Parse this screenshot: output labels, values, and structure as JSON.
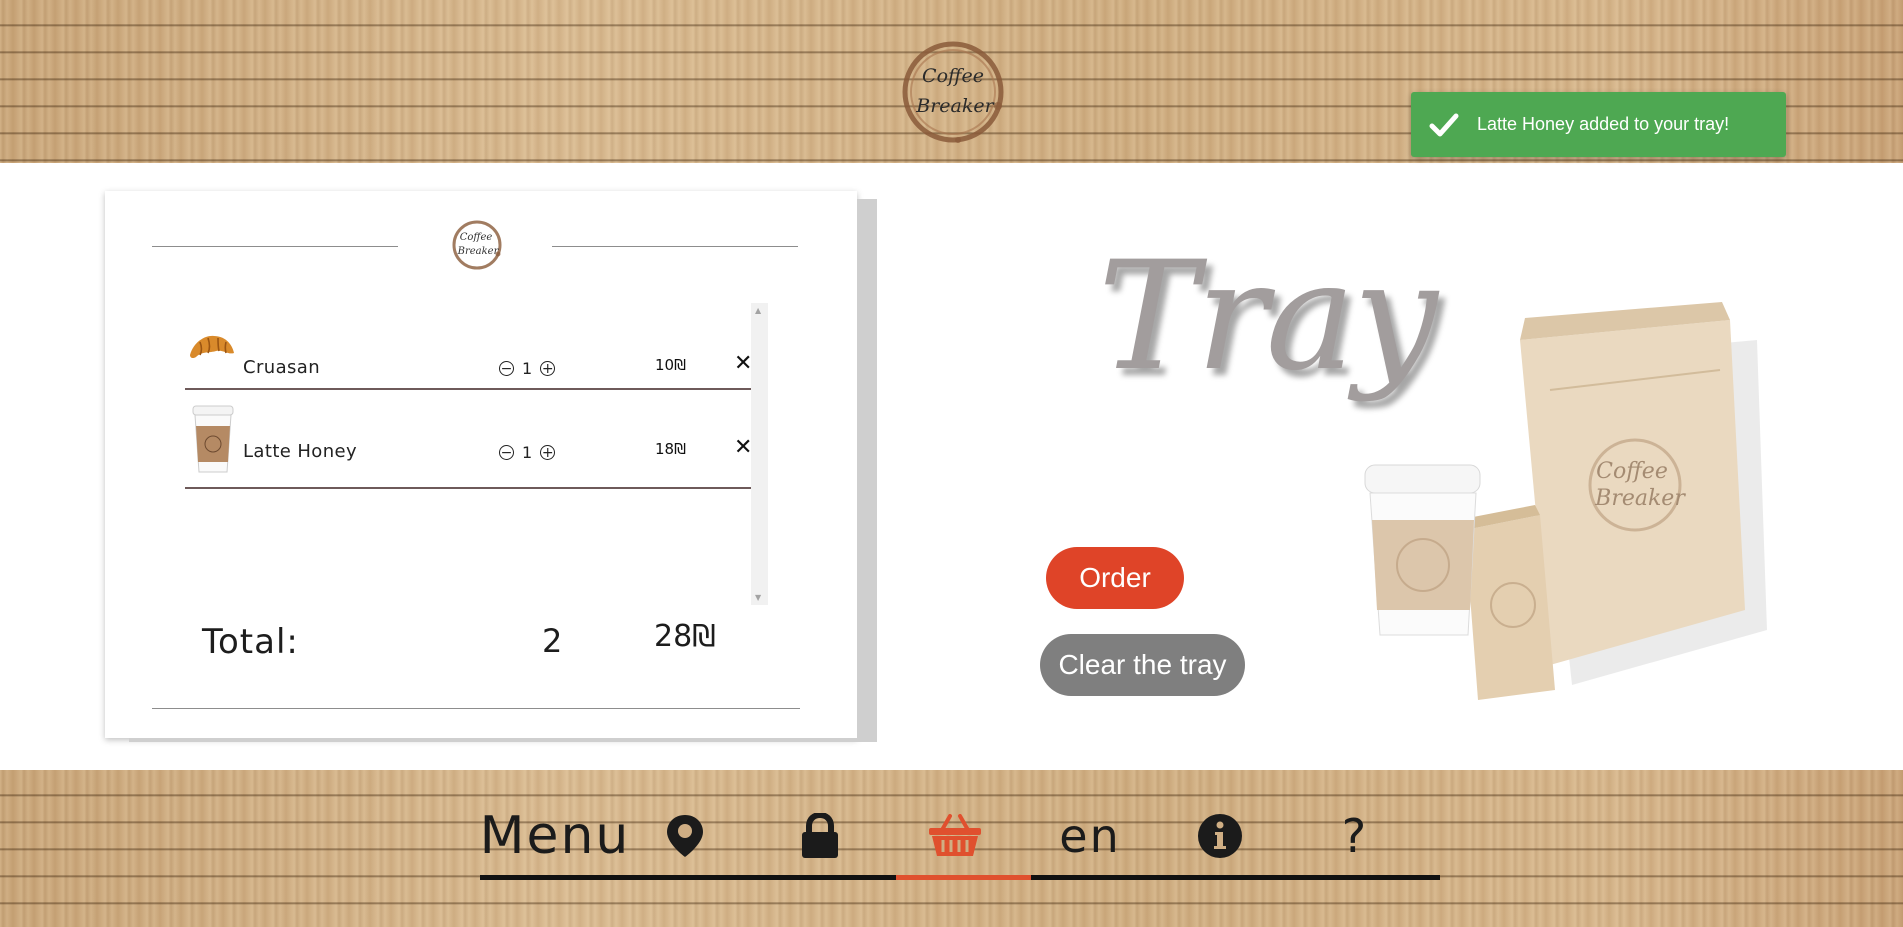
{
  "header": {
    "logo_text": [
      "Coffee",
      "Breaker"
    ]
  },
  "toast": {
    "message": "Latte Honey added to your tray!",
    "icon": "check-icon",
    "color": "#4ea852"
  },
  "tray_card": {
    "logo_text": [
      "Coffee",
      "Breaker"
    ],
    "items": [
      {
        "name": "Cruasan",
        "quantity": "1",
        "price": "10₪",
        "image": "croissant"
      },
      {
        "name": "Latte Honey",
        "quantity": "1",
        "price": "18₪",
        "image": "coffee-cup"
      }
    ],
    "total_label": "Total:",
    "total_count": "2",
    "total_sum": "28₪"
  },
  "page": {
    "title": "Tray",
    "order_button": "Order",
    "clear_button": "Clear the tray",
    "bag_logo_text": [
      "Coffee",
      "Breaker"
    ],
    "accent_color": "#df4428",
    "clear_color": "#7f7f7f"
  },
  "nav": {
    "menu_label": "Menu",
    "language_label": "en",
    "help_label": "?",
    "icons": [
      "map-pin-icon",
      "lock-icon",
      "basket-icon",
      "info-icon"
    ],
    "active_item": "basket",
    "active_color": "#e0502e"
  }
}
